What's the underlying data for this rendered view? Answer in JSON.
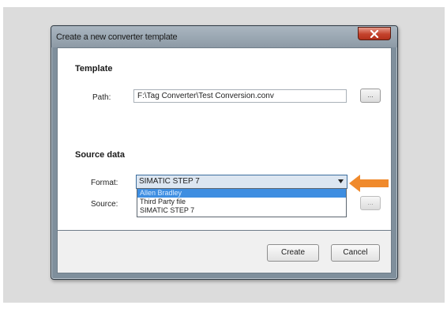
{
  "dialog": {
    "title": "Create a new converter template",
    "close_icon": "close-icon"
  },
  "template_section": {
    "heading": "Template",
    "path_label": "Path:",
    "path_value": "F:\\Tag Converter\\Test Conversion.conv",
    "browse_label": "..."
  },
  "source_section": {
    "heading": "Source data",
    "format_label": "Format:",
    "format_value": "SIMATIC STEP 7",
    "source_label": "Source:",
    "browse_label": "...",
    "options": [
      "Allen Bradley",
      "Third Party file",
      "SIMATIC STEP 7"
    ],
    "highlighted_option": "Allen Bradley"
  },
  "footer": {
    "create_label": "Create",
    "cancel_label": "Cancel"
  },
  "annotation": {
    "pointer_icon": "arrow-left-icon",
    "pointer_color": "#f08a2c"
  }
}
